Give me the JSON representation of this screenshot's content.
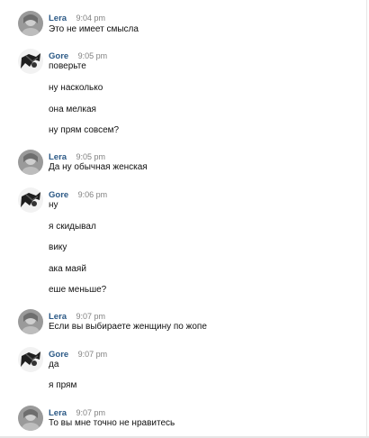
{
  "messages": [
    {
      "author": "Lera",
      "time": "9:04 pm",
      "lines": [
        "Это не имеет смысла"
      ]
    },
    {
      "author": "Gore",
      "time": "9:05 pm",
      "lines": [
        "поверьте",
        "ну насколько",
        "она мелкая",
        "ну прям совсем?"
      ]
    },
    {
      "author": "Lera",
      "time": "9:05 pm",
      "lines": [
        "Да ну обычная женская"
      ]
    },
    {
      "author": "Gore",
      "time": "9:06 pm",
      "lines": [
        "ну",
        "я скидывал",
        "вику",
        "ака маяй",
        "еше меньше?"
      ]
    },
    {
      "author": "Lera",
      "time": "9:07 pm",
      "lines": [
        "Если вы выбираете женщину по жопе"
      ]
    },
    {
      "author": "Gore",
      "time": "9:07 pm",
      "lines": [
        "да",
        "я прям"
      ]
    },
    {
      "author": "Lera",
      "time": "9:07 pm",
      "lines": [
        "То вы мне точно не нравитесь"
      ]
    }
  ],
  "colors": {
    "author": "#2a5885",
    "time": "#828282",
    "text": "#111111"
  }
}
